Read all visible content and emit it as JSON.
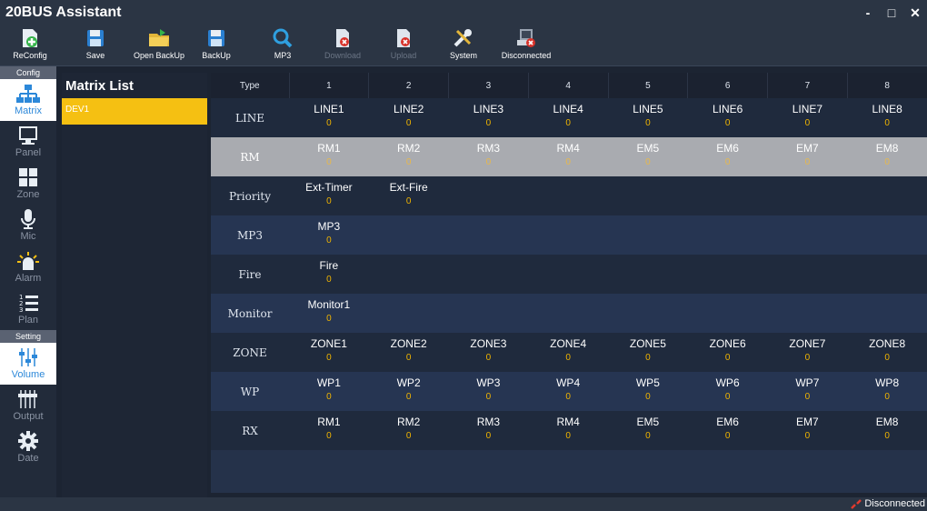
{
  "app": {
    "title": "20BUS Assistant"
  },
  "window": {
    "minimize": "-",
    "maximize": "□",
    "close": "✕"
  },
  "toolbar": [
    {
      "label": "ReConfig",
      "icon": "reconfig-icon",
      "enabled": true
    },
    {
      "label": "Save",
      "icon": "save-icon",
      "enabled": true
    },
    {
      "label": "Open BackUp",
      "icon": "open-folder-icon",
      "enabled": true
    },
    {
      "label": "BackUp",
      "icon": "backup-icon",
      "enabled": true
    },
    {
      "label": "MP3",
      "icon": "search-icon",
      "enabled": true
    },
    {
      "label": "Download",
      "icon": "download-icon",
      "enabled": false
    },
    {
      "label": "Upload",
      "icon": "upload-icon",
      "enabled": false
    },
    {
      "label": "System",
      "icon": "tools-icon",
      "enabled": true
    },
    {
      "label": "Disconnected",
      "icon": "disconnected-icon",
      "enabled": true
    }
  ],
  "sidebar": {
    "config_header": "Config",
    "setting_header": "Setting",
    "items": [
      {
        "label": "Matrix",
        "icon": "matrix-icon"
      },
      {
        "label": "Panel",
        "icon": "panel-icon"
      },
      {
        "label": "Zone",
        "icon": "zone-icon"
      },
      {
        "label": "Mic",
        "icon": "mic-icon"
      },
      {
        "label": "Alarm",
        "icon": "alarm-icon"
      },
      {
        "label": "Plan",
        "icon": "plan-icon"
      },
      {
        "label": "Volume",
        "icon": "volume-icon"
      },
      {
        "label": "Output",
        "icon": "output-icon"
      },
      {
        "label": "Date",
        "icon": "gear-icon"
      }
    ]
  },
  "matrix_list": {
    "title": "Matrix List",
    "items": [
      "DEV1"
    ]
  },
  "grid": {
    "columns": [
      "Type",
      "1",
      "2",
      "3",
      "4",
      "5",
      "6",
      "7",
      "8"
    ],
    "rows": [
      {
        "type": "LINE",
        "cells": [
          [
            "LINE1",
            "0"
          ],
          [
            "LINE2",
            "0"
          ],
          [
            "LINE3",
            "0"
          ],
          [
            "LINE4",
            "0"
          ],
          [
            "LINE5",
            "0"
          ],
          [
            "LINE6",
            "0"
          ],
          [
            "LINE7",
            "0"
          ],
          [
            "LINE8",
            "0"
          ]
        ]
      },
      {
        "type": "RM",
        "cells": [
          [
            "RM1",
            "0"
          ],
          [
            "RM2",
            "0"
          ],
          [
            "RM3",
            "0"
          ],
          [
            "RM4",
            "0"
          ],
          [
            "EM5",
            "0"
          ],
          [
            "EM6",
            "0"
          ],
          [
            "EM7",
            "0"
          ],
          [
            "EM8",
            "0"
          ]
        ]
      },
      {
        "type": "Priority",
        "cells": [
          [
            "Ext-Timer",
            "0"
          ],
          [
            "Ext-Fire",
            "0"
          ]
        ]
      },
      {
        "type": "MP3",
        "cells": [
          [
            "MP3",
            "0"
          ]
        ]
      },
      {
        "type": "Fire",
        "cells": [
          [
            "Fire",
            "0"
          ]
        ]
      },
      {
        "type": "Monitor",
        "cells": [
          [
            "Monitor1",
            "0"
          ]
        ]
      },
      {
        "type": "ZONE",
        "cells": [
          [
            "ZONE1",
            "0"
          ],
          [
            "ZONE2",
            "0"
          ],
          [
            "ZONE3",
            "0"
          ],
          [
            "ZONE4",
            "0"
          ],
          [
            "ZONE5",
            "0"
          ],
          [
            "ZONE6",
            "0"
          ],
          [
            "ZONE7",
            "0"
          ],
          [
            "ZONE8",
            "0"
          ]
        ]
      },
      {
        "type": "WP",
        "cells": [
          [
            "WP1",
            "0"
          ],
          [
            "WP2",
            "0"
          ],
          [
            "WP3",
            "0"
          ],
          [
            "WP4",
            "0"
          ],
          [
            "WP5",
            "0"
          ],
          [
            "WP6",
            "0"
          ],
          [
            "WP7",
            "0"
          ],
          [
            "WP8",
            "0"
          ]
        ]
      },
      {
        "type": "RX",
        "cells": [
          [
            "RM1",
            "0"
          ],
          [
            "RM2",
            "0"
          ],
          [
            "RM3",
            "0"
          ],
          [
            "RM4",
            "0"
          ],
          [
            "EM5",
            "0"
          ],
          [
            "EM6",
            "0"
          ],
          [
            "EM7",
            "0"
          ],
          [
            "EM8",
            "0"
          ]
        ]
      }
    ]
  },
  "status": {
    "text": "Disconnected"
  },
  "colors": {
    "accent": "#f5c012",
    "value": "#f0b400",
    "selected_row": "#a9abb0",
    "active_blue": "#2c88d9"
  }
}
